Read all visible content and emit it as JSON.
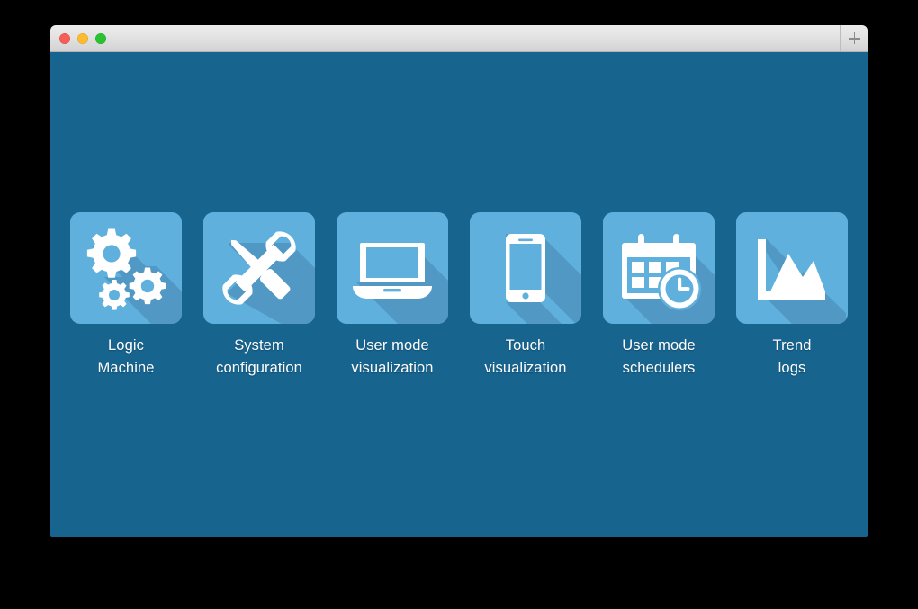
{
  "window": {
    "titlebar": {
      "close_label": "close",
      "minimize_label": "minimize",
      "maximize_label": "maximize",
      "new_tab_label": "+"
    },
    "background_color": "#17648F",
    "tile_color": "#5FB0DC",
    "tile_shadow_color": "#5298C4",
    "icon_color": "#FFFFFF",
    "label_color": "#FFFFFF"
  },
  "launcher": {
    "tiles": [
      {
        "label": "Logic\nMachine",
        "icon": "gears-icon"
      },
      {
        "label": "System\nconfiguration",
        "icon": "wrench-screwdriver-icon"
      },
      {
        "label": "User mode\nvisualization",
        "icon": "laptop-icon"
      },
      {
        "label": "Touch\nvisualization",
        "icon": "smartphone-icon"
      },
      {
        "label": "User mode\nschedulers",
        "icon": "calendar-clock-icon"
      },
      {
        "label": "Trend\nlogs",
        "icon": "area-chart-icon"
      }
    ]
  }
}
